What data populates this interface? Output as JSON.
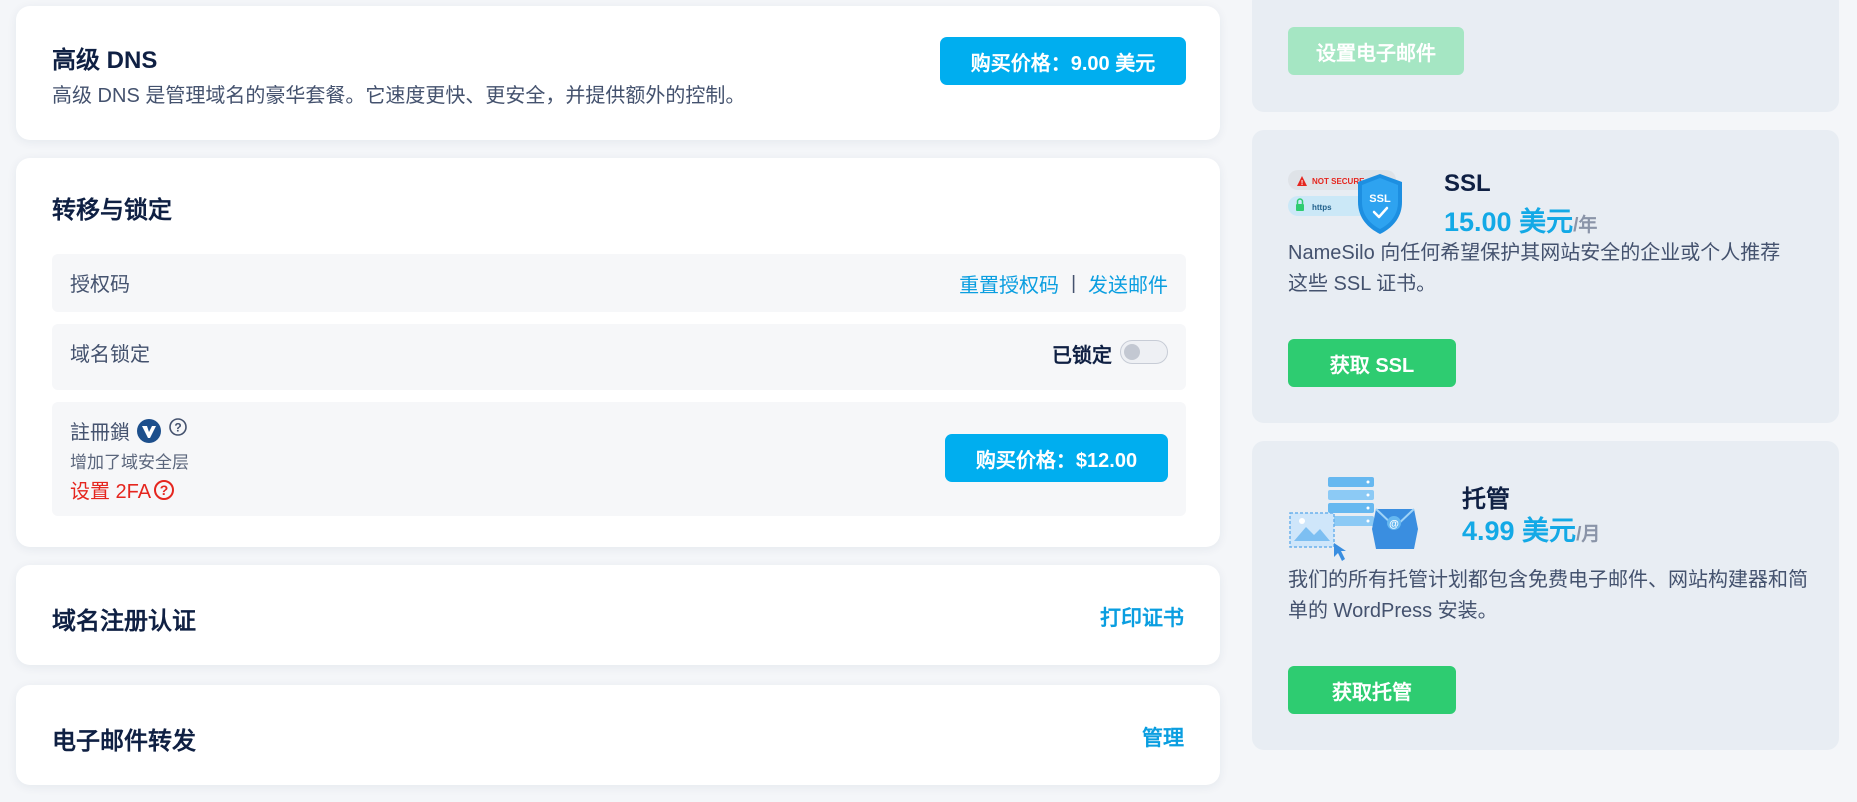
{
  "premium_dns": {
    "title": "高级 DNS",
    "description": "高级 DNS 是管理域名的豪华套餐。它速度更快、更安全，并提供额外的控制。",
    "buy_label": "购买价格：9.00 美元"
  },
  "transfer_lock": {
    "title": "转移与锁定",
    "auth_code": {
      "label": "授权码",
      "reset_link": "重置授权码",
      "separator": "|",
      "send_link": "发送邮件"
    },
    "domain_lock": {
      "label": "域名锁定",
      "status": "已锁定",
      "enabled": false
    },
    "registry_lock": {
      "label": "註冊鎖",
      "subtitle": "增加了域安全层",
      "setup_2fa": "设置 2FA",
      "buy_label": "购买价格：$12.00"
    }
  },
  "certificate": {
    "title": "域名注册认证",
    "action": "打印证书"
  },
  "email_forwarding": {
    "title": "电子邮件转发",
    "action": "管理"
  },
  "sidebar": {
    "email_card": {
      "button": "设置电子邮件"
    },
    "ssl_card": {
      "image_badge_1": "NOT SECURE",
      "image_badge_2": "https",
      "image_shield": "SSL",
      "title": "SSL",
      "price": "15.00 美元",
      "unit": "/年",
      "description": "NameSilo 向任何希望保护其网站安全的企业或个人推荐这些 SSL 证书。",
      "button": "获取 SSL"
    },
    "hosting_card": {
      "title": "托管",
      "price": "4.99 美元",
      "unit": "/月",
      "description": "我们的所有托管计划都包含免费电子邮件、网站构建器和简单的 WordPress 安装。",
      "button": "获取托管"
    }
  },
  "colors": {
    "accent_blue": "#00aeef",
    "accent_green": "#2ecc71",
    "warning_red": "#e5261f",
    "navy": "#0f2043"
  },
  "icons": [
    "verisign-icon",
    "help-icon",
    "red-help-icon",
    "ssl-illustration",
    "hosting-illustration"
  ]
}
